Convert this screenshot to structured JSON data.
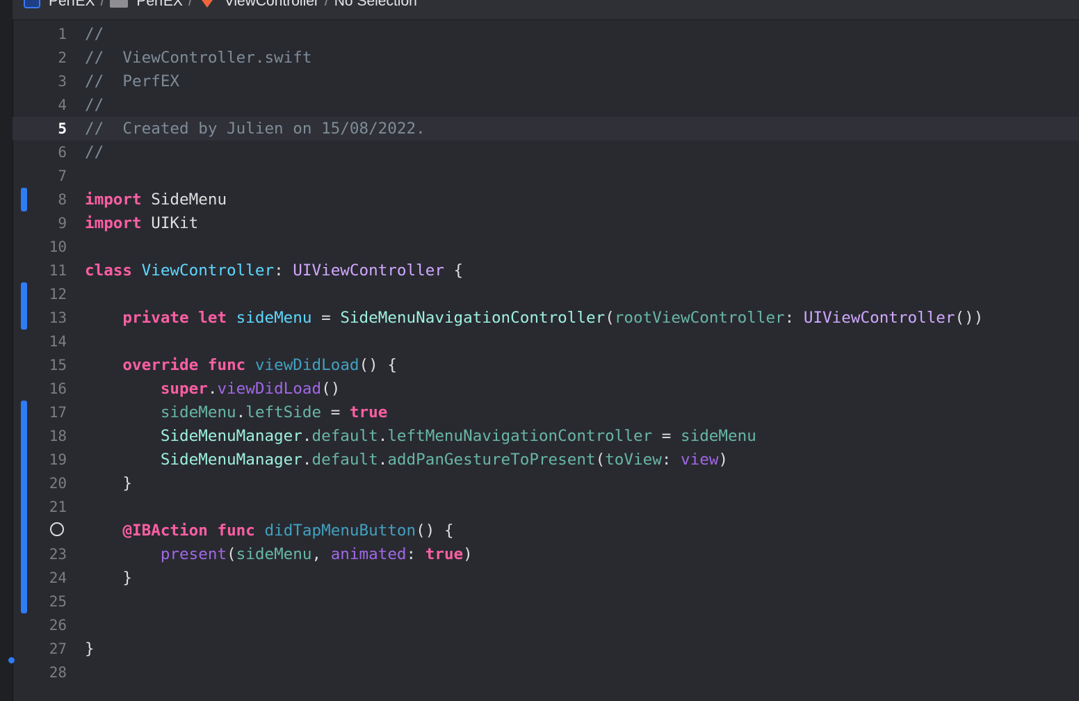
{
  "breadcrumb": {
    "project": "PerfEX",
    "folder": "PerfEX",
    "file": "ViewController",
    "selection": "No Selection",
    "separator": "/"
  },
  "editor": {
    "current_line": 5,
    "lines": [
      {
        "n": "1",
        "tokens": [
          {
            "text": "//",
            "c": "c"
          }
        ]
      },
      {
        "n": "2",
        "tokens": [
          {
            "text": "//  ViewController.swift",
            "c": "c"
          }
        ]
      },
      {
        "n": "3",
        "tokens": [
          {
            "text": "//  PerfEX",
            "c": "c"
          }
        ]
      },
      {
        "n": "4",
        "tokens": [
          {
            "text": "//",
            "c": "c"
          }
        ]
      },
      {
        "n": "5",
        "tokens": [
          {
            "text": "//  Created by Julien on 15/08/2022.",
            "c": "c"
          }
        ]
      },
      {
        "n": "6",
        "tokens": [
          {
            "text": "//",
            "c": "c"
          }
        ]
      },
      {
        "n": "7",
        "tokens": []
      },
      {
        "n": "8",
        "tokens": [
          {
            "text": "import",
            "c": "k"
          },
          {
            "text": " SideMenu",
            "c": ""
          }
        ]
      },
      {
        "n": "9",
        "tokens": [
          {
            "text": "import",
            "c": "k"
          },
          {
            "text": " UIKit",
            "c": ""
          }
        ]
      },
      {
        "n": "10",
        "tokens": []
      },
      {
        "n": "11",
        "tokens": [
          {
            "text": "class",
            "c": "k"
          },
          {
            "text": " ",
            "c": ""
          },
          {
            "text": "ViewController",
            "c": "t"
          },
          {
            "text": ": ",
            "c": ""
          },
          {
            "text": "UIViewController",
            "c": "ty"
          },
          {
            "text": " {",
            "c": ""
          }
        ]
      },
      {
        "n": "12",
        "tokens": []
      },
      {
        "n": "13",
        "tokens": [
          {
            "text": "    ",
            "c": ""
          },
          {
            "text": "private",
            "c": "k"
          },
          {
            "text": " ",
            "c": ""
          },
          {
            "text": "let",
            "c": "k"
          },
          {
            "text": " ",
            "c": ""
          },
          {
            "text": "sideMenu",
            "c": "t"
          },
          {
            "text": " = ",
            "c": ""
          },
          {
            "text": "SideMenuNavigationController",
            "c": "pt"
          },
          {
            "text": "(",
            "c": ""
          },
          {
            "text": "rootViewController",
            "c": "pr"
          },
          {
            "text": ": ",
            "c": ""
          },
          {
            "text": "UIViewController",
            "c": "ty"
          },
          {
            "text": "())",
            "c": ""
          }
        ]
      },
      {
        "n": "14",
        "tokens": []
      },
      {
        "n": "15",
        "tokens": [
          {
            "text": "    ",
            "c": ""
          },
          {
            "text": "override",
            "c": "k"
          },
          {
            "text": " ",
            "c": ""
          },
          {
            "text": "func",
            "c": "k"
          },
          {
            "text": " ",
            "c": ""
          },
          {
            "text": "viewDidLoad",
            "c": "pf"
          },
          {
            "text": "() {",
            "c": ""
          }
        ]
      },
      {
        "n": "16",
        "tokens": [
          {
            "text": "        ",
            "c": ""
          },
          {
            "text": "super",
            "c": "k"
          },
          {
            "text": ".",
            "c": ""
          },
          {
            "text": "viewDidLoad",
            "c": "sy"
          },
          {
            "text": "()",
            "c": ""
          }
        ]
      },
      {
        "n": "17",
        "tokens": [
          {
            "text": "        ",
            "c": ""
          },
          {
            "text": "sideMenu",
            "c": "pr"
          },
          {
            "text": ".",
            "c": ""
          },
          {
            "text": "leftSide",
            "c": "pr"
          },
          {
            "text": " = ",
            "c": ""
          },
          {
            "text": "true",
            "c": "k"
          }
        ]
      },
      {
        "n": "18",
        "tokens": [
          {
            "text": "        ",
            "c": ""
          },
          {
            "text": "SideMenuManager",
            "c": "pt"
          },
          {
            "text": ".",
            "c": ""
          },
          {
            "text": "default",
            "c": "pr"
          },
          {
            "text": ".",
            "c": ""
          },
          {
            "text": "leftMenuNavigationController",
            "c": "pr"
          },
          {
            "text": " = ",
            "c": ""
          },
          {
            "text": "sideMenu",
            "c": "pr"
          }
        ]
      },
      {
        "n": "19",
        "tokens": [
          {
            "text": "        ",
            "c": ""
          },
          {
            "text": "SideMenuManager",
            "c": "pt"
          },
          {
            "text": ".",
            "c": ""
          },
          {
            "text": "default",
            "c": "pr"
          },
          {
            "text": ".",
            "c": ""
          },
          {
            "text": "addPanGestureToPresent",
            "c": "pr"
          },
          {
            "text": "(",
            "c": ""
          },
          {
            "text": "toView",
            "c": "pr"
          },
          {
            "text": ": ",
            "c": ""
          },
          {
            "text": "view",
            "c": "sy"
          },
          {
            "text": ")",
            "c": ""
          }
        ]
      },
      {
        "n": "20",
        "tokens": [
          {
            "text": "    }",
            "c": ""
          }
        ]
      },
      {
        "n": "21",
        "tokens": []
      },
      {
        "n": "",
        "tokens": [
          {
            "text": "    ",
            "c": ""
          },
          {
            "text": "@IBAction",
            "c": "k"
          },
          {
            "text": " ",
            "c": ""
          },
          {
            "text": "func",
            "c": "k"
          },
          {
            "text": " ",
            "c": ""
          },
          {
            "text": "didTapMenuButton",
            "c": "pf"
          },
          {
            "text": "() {",
            "c": ""
          }
        ]
      },
      {
        "n": "23",
        "tokens": [
          {
            "text": "        ",
            "c": ""
          },
          {
            "text": "present",
            "c": "sy"
          },
          {
            "text": "(",
            "c": ""
          },
          {
            "text": "sideMenu",
            "c": "pr"
          },
          {
            "text": ", ",
            "c": ""
          },
          {
            "text": "animated",
            "c": "sy"
          },
          {
            "text": ": ",
            "c": ""
          },
          {
            "text": "true",
            "c": "k"
          },
          {
            "text": ")",
            "c": ""
          }
        ]
      },
      {
        "n": "24",
        "tokens": [
          {
            "text": "    }",
            "c": ""
          }
        ]
      },
      {
        "n": "25",
        "tokens": []
      },
      {
        "n": "26",
        "tokens": []
      },
      {
        "n": "27",
        "tokens": [
          {
            "text": "}",
            "c": ""
          }
        ]
      },
      {
        "n": "28",
        "tokens": []
      }
    ]
  }
}
